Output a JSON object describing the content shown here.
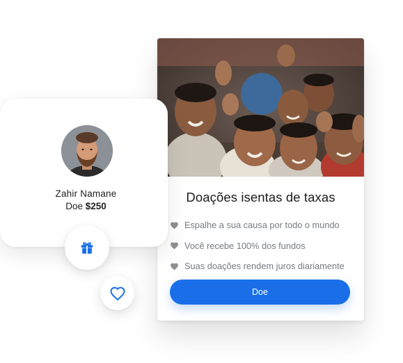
{
  "profile": {
    "name": "Zahir Namane",
    "amount_prefix": "Doe",
    "amount": "$250"
  },
  "card": {
    "title": "Doações isentas de taxas",
    "features": [
      {
        "icon": "heart-icon",
        "text": "Espalhe a sua causa por todo o mundo"
      },
      {
        "icon": "heart-icon",
        "text": "Você recebe 100% dos fundos"
      },
      {
        "icon": "heart-icon",
        "text": "Suas doações rendem juros diariamente"
      }
    ],
    "button_label": "Doe"
  },
  "icons": {
    "gift": "gift-icon",
    "like": "heart-outline-icon",
    "feature": "heart-icon"
  },
  "colors": {
    "accent": "#1a6fe8",
    "feature_icon": "#8e8f93",
    "feature_text": "#777b80",
    "title": "#1b1b1b"
  }
}
